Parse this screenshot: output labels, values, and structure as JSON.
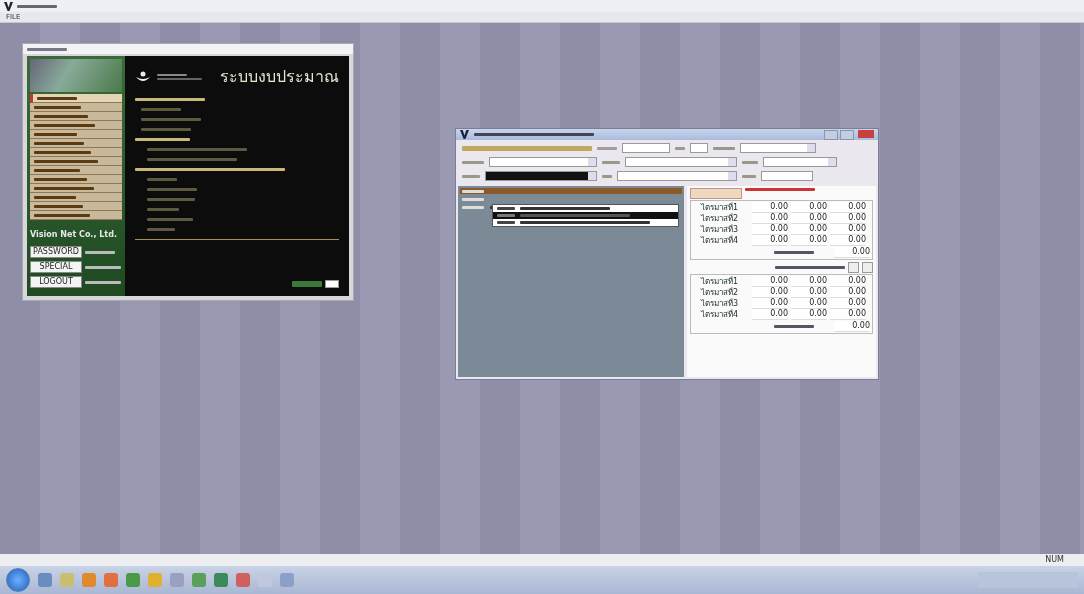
{
  "window": {
    "menu": [
      "FILE"
    ]
  },
  "budget_window": {
    "heading": "ระบบงบประมาณ",
    "company": "Vision Net Co., Ltd.",
    "menu_items": [
      {
        "selected": true
      },
      {
        "selected": false
      },
      {
        "selected": false
      },
      {
        "selected": false
      },
      {
        "selected": false
      },
      {
        "selected": false
      },
      {
        "selected": false
      },
      {
        "selected": false
      },
      {
        "selected": false
      },
      {
        "selected": false
      },
      {
        "selected": false
      },
      {
        "selected": false
      },
      {
        "selected": false
      },
      {
        "selected": false
      }
    ],
    "buttons": [
      "PASSWORD",
      "SPECIAL",
      "LOGOUT"
    ]
  },
  "entry_dialog": {
    "dropdown_items": [
      {
        "selected": false
      },
      {
        "selected": true
      },
      {
        "selected": false
      }
    ],
    "list_rows": [
      {
        "selected": true
      },
      {
        "selected": false
      },
      {
        "selected": false
      }
    ],
    "upper_grid": {
      "rows": [
        {
          "label": "ไตรมาสที่1",
          "values": [
            "0.00",
            "0.00",
            "0.00"
          ]
        },
        {
          "label": "ไตรมาสที่2",
          "values": [
            "0.00",
            "0.00",
            "0.00"
          ]
        },
        {
          "label": "ไตรมาสที่3",
          "values": [
            "0.00",
            "0.00",
            "0.00"
          ]
        },
        {
          "label": "ไตรมาสที่4",
          "values": [
            "0.00",
            "0.00",
            "0.00"
          ]
        }
      ],
      "total": "0.00"
    },
    "lower_grid": {
      "rows": [
        {
          "label": "ไตรมาสที่1",
          "values": [
            "0.00",
            "0.00",
            "0.00"
          ]
        },
        {
          "label": "ไตรมาสที่2",
          "values": [
            "0.00",
            "0.00",
            "0.00"
          ]
        },
        {
          "label": "ไตรมาสที่3",
          "values": [
            "0.00",
            "0.00",
            "0.00"
          ]
        },
        {
          "label": "ไตรมาสที่4",
          "values": [
            "0.00",
            "0.00",
            "0.00"
          ]
        }
      ],
      "total": "0.00"
    }
  },
  "status_bar": {
    "indicator": "NUM"
  }
}
